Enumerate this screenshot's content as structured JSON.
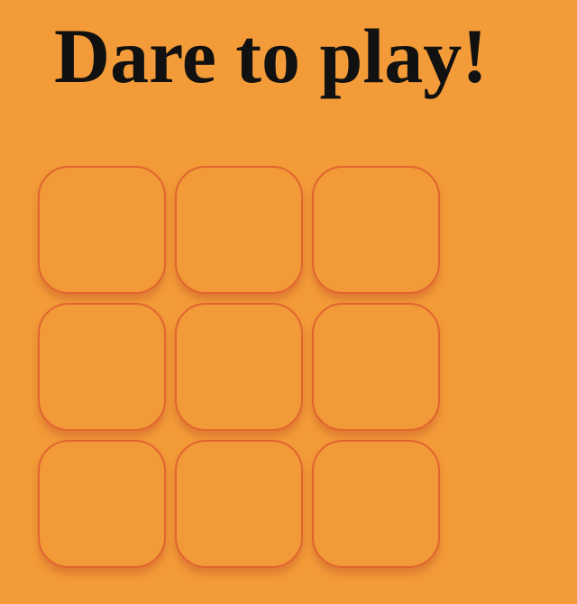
{
  "title": "Dare to play!",
  "board": {
    "cells": [
      "",
      "",
      "",
      "",
      "",
      "",
      "",
      "",
      ""
    ]
  },
  "colors": {
    "background": "#f39b38",
    "cell_border": "#e0652f",
    "title_text": "#111111"
  }
}
